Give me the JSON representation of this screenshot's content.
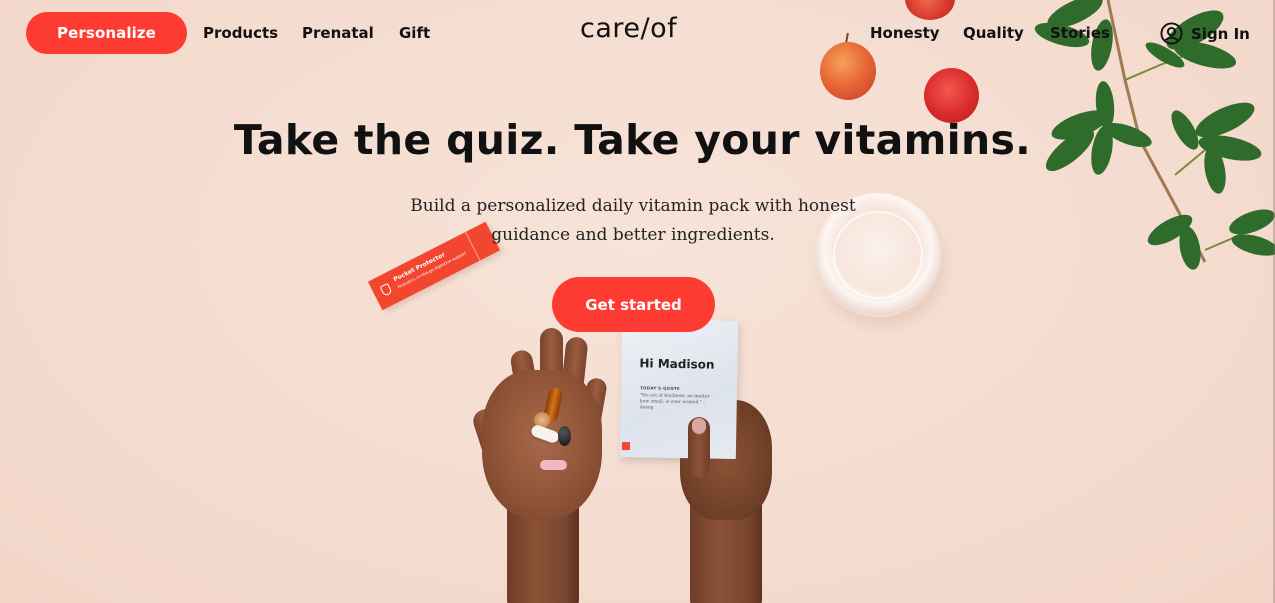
{
  "nav": {
    "personalize_label": "Personalize",
    "left_links": [
      "Products",
      "Prenatal",
      "Gift"
    ],
    "logo": "care/of",
    "right_links": [
      "Honesty",
      "Quality",
      "Stories"
    ],
    "signin_label": "Sign In",
    "signin_icon": "user-circle-icon"
  },
  "hero": {
    "headline": "Take the quiz. Take your vitamins.",
    "subtext": "Build a personalized daily vitamin pack with honest guidance and better ingredients.",
    "cta_label": "Get started"
  },
  "imagery": {
    "packet_title": "Pocket Protector",
    "packet_subtitle": "Probiotics on-the-go digestive support",
    "pouch_greeting": "Hi Madison",
    "pouch_quote_label": "TODAY'S QUOTE",
    "pouch_quote": "\"No act of kindness, no matter how small, is ever wasted.\" - Aesop"
  },
  "colors": {
    "accent": "#fe3b33",
    "background": "#f5dfd3",
    "text": "#111111"
  }
}
